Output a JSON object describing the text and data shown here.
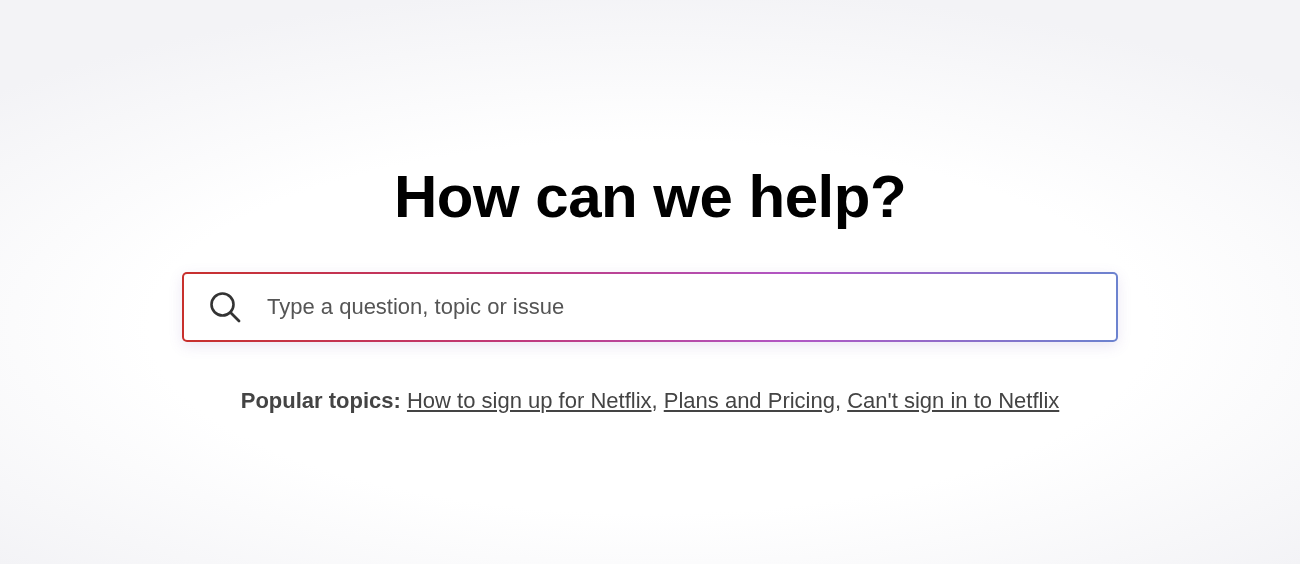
{
  "heading": "How can we help?",
  "search": {
    "placeholder": "Type a question, topic or issue"
  },
  "popular_topics": {
    "label": "**Popular topics:**",
    "separator": ",",
    "links": [
      {
        "text": "How to sign up for Netflix"
      },
      {
        "text": "Plans and Pricing"
      },
      {
        "text": "Can't sign in to Netflix"
      }
    ]
  }
}
